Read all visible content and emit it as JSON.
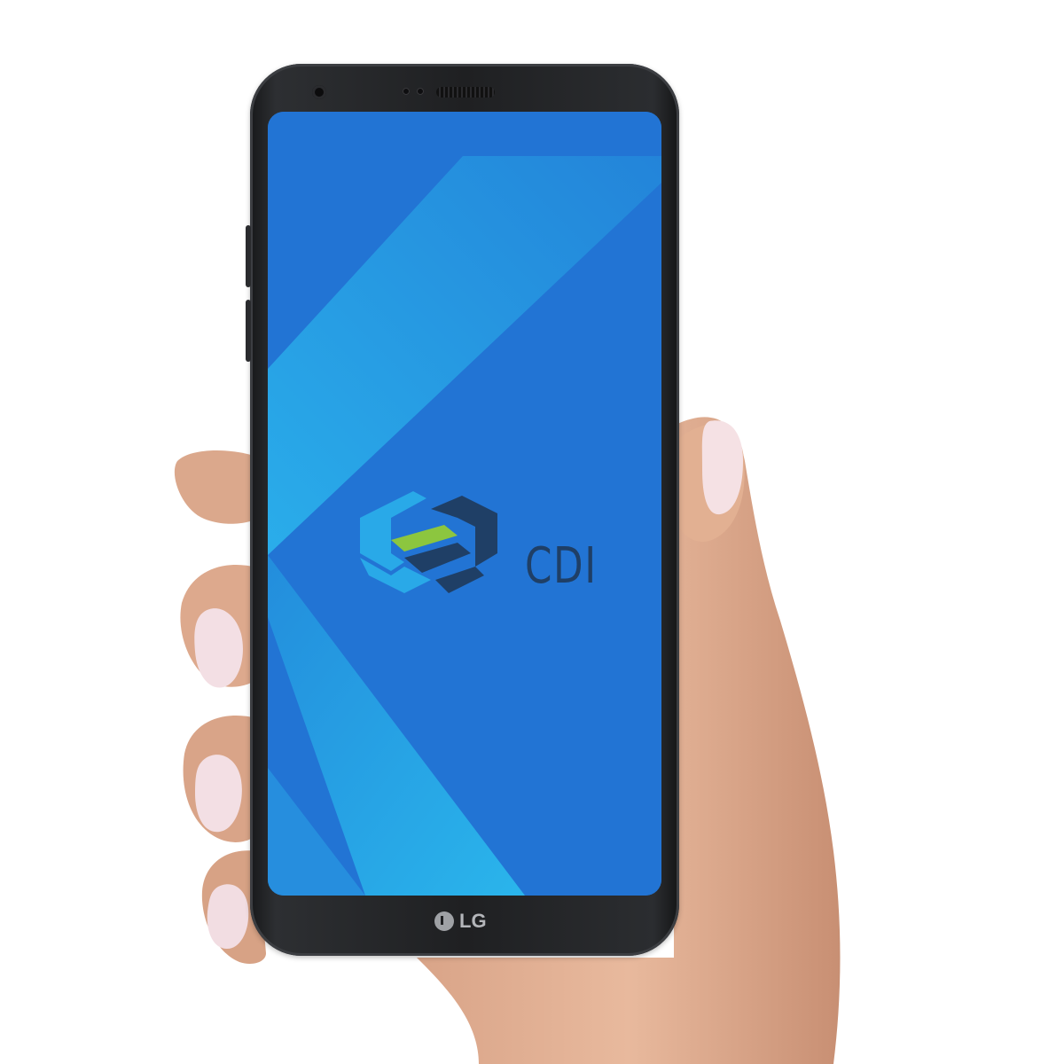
{
  "phone": {
    "brand_label": "LG"
  },
  "screen": {
    "app_name": "CDI",
    "logo_icon": "cdi-logo-icon",
    "background_color": "#2274d4"
  },
  "colors": {
    "stripe_light": "#28b4ea",
    "logo_light_blue": "#29a9e8",
    "logo_green": "#8cc63f",
    "logo_dark_navy": "#1f3f66"
  }
}
